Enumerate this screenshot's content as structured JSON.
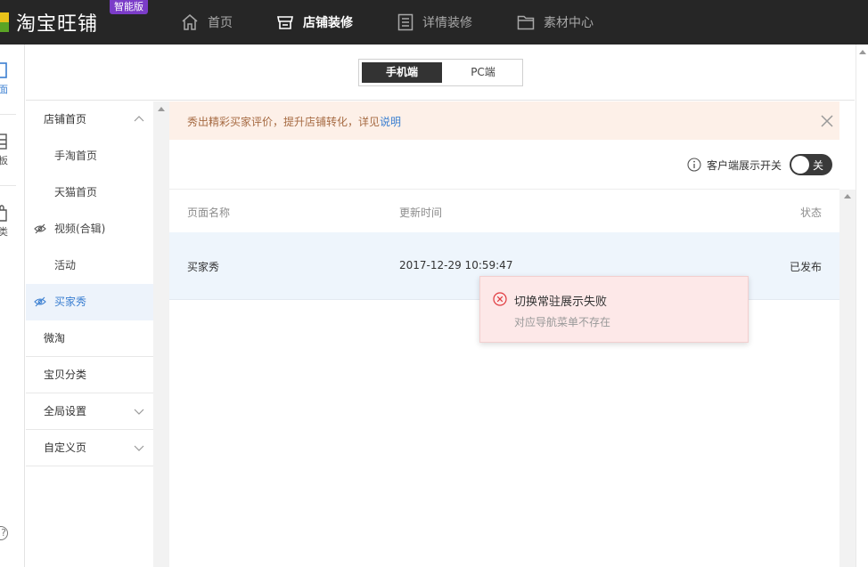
{
  "app": {
    "logo_text": "淘宝旺铺",
    "badge": "智能版"
  },
  "nav": [
    {
      "label": "首页",
      "icon": "home-icon"
    },
    {
      "label": "店铺装修",
      "icon": "store-icon"
    },
    {
      "label": "详情装修",
      "icon": "detail-page-icon"
    },
    {
      "label": "素材中心",
      "icon": "folder-icon"
    }
  ],
  "rail": {
    "items": [
      {
        "label": "面",
        "icon": "page-icon"
      },
      {
        "label": "板",
        "icon": "template-icon"
      },
      {
        "label": "类",
        "icon": "bag-icon"
      }
    ],
    "help_label": "?"
  },
  "device_switch": {
    "mobile": "手机端",
    "pc": "PC端"
  },
  "sidebar": {
    "items": [
      {
        "label": "店铺首页"
      },
      {
        "label": "手淘首页"
      },
      {
        "label": "天猫首页"
      },
      {
        "label": "视频(合辑)"
      },
      {
        "label": "活动"
      },
      {
        "label": "买家秀"
      },
      {
        "label": "微淘"
      },
      {
        "label": "宝贝分类"
      },
      {
        "label": "全局设置"
      },
      {
        "label": "自定义页"
      }
    ]
  },
  "notice": {
    "text": "秀出精彩买家评价，提升店铺转化，详见",
    "link": "说明"
  },
  "toggle": {
    "label": "客户端展示开关",
    "state": "关"
  },
  "table": {
    "headers": [
      "页面名称",
      "更新时间",
      "状态"
    ],
    "rows": [
      {
        "name": "买家秀",
        "time": "2017-12-29 10:59:47",
        "status": "已发布"
      }
    ]
  },
  "toast": {
    "title": "切换常驻展示失败",
    "desc": "对应导航菜单不存在"
  },
  "colors": {
    "topbar": "#262626",
    "accent": "#3b7fd1",
    "badge": "#7b3cc8",
    "notice_bg": "#fdf0e8",
    "toast_bg": "#fde8e8",
    "error": "#e0393e"
  }
}
